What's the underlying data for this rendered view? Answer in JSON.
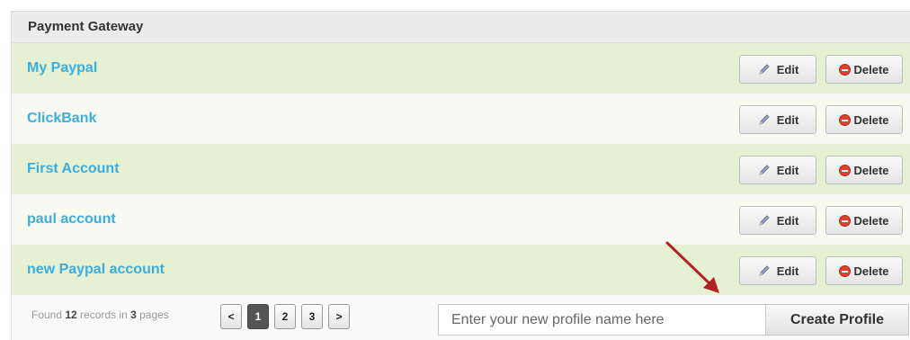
{
  "panel": {
    "title": "Payment Gateway"
  },
  "rows": [
    {
      "name": "My Paypal"
    },
    {
      "name": "ClickBank"
    },
    {
      "name": "First Account"
    },
    {
      "name": "paul account"
    },
    {
      "name": "new Paypal account"
    }
  ],
  "actions": {
    "edit_label": "Edit",
    "delete_label": "Delete"
  },
  "footer": {
    "found_prefix": "Found ",
    "records": "12",
    "records_mid": " records in ",
    "pages": "3",
    "pages_suffix": " pages",
    "pager": {
      "prev": "<",
      "pages": [
        "1",
        "2",
        "3"
      ],
      "next": ">",
      "current": "1"
    },
    "new_profile_placeholder": "Enter your new profile name here",
    "create_label": "Create Profile"
  },
  "colors": {
    "link": "#3aaee0",
    "row_green": "#e6f0d3",
    "row_light": "#f8faf2",
    "arrow": "#b22222",
    "delete_red": "#e0412e"
  },
  "icons": {
    "edit": "pencil-icon",
    "delete": "minus-circle-icon",
    "annotation": "red-arrow-icon"
  }
}
